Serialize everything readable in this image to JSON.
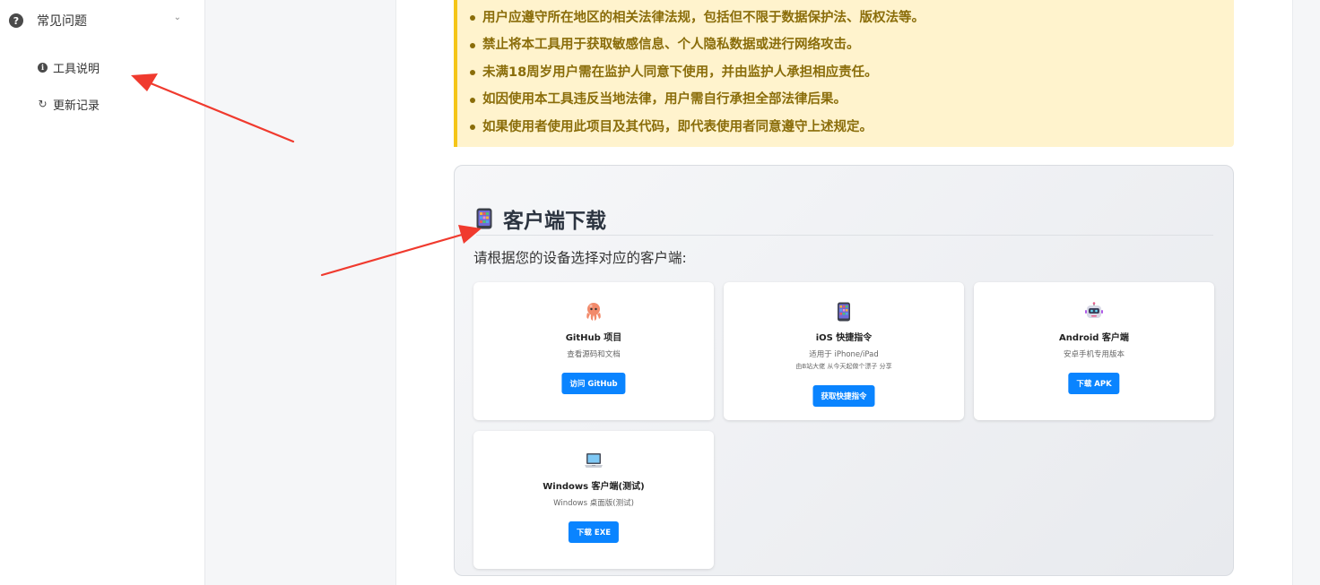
{
  "sidebar": {
    "faq_label": "常见问题",
    "items": [
      {
        "label": "工具说明",
        "icon": "info-icon"
      },
      {
        "label": "更新记录",
        "icon": "refresh-icon"
      }
    ]
  },
  "warning": {
    "items": [
      "用户应遵守所在地区的相关法律法规，包括但不限于数据保护法、版权法等。",
      "禁止将本工具用于获取敏感信息、个人隐私数据或进行网络攻击。",
      "未满18周岁用户需在监护人同意下使用，并由监护人承担相应责任。",
      "如因使用本工具违反当地法律，用户需自行承担全部法律后果。",
      "如果使用者使用此项目及其代码，即代表使用者同意遵守上述规定。"
    ]
  },
  "download": {
    "title": "客户端下载",
    "subtitle": "请根据您的设备选择对应的客户端:",
    "cards": [
      {
        "icon": "octopus-icon",
        "title": "GitHub 项目",
        "desc": "查看源码和文档",
        "button": "访问 GitHub"
      },
      {
        "icon": "phone-icon",
        "title": "iOS 快捷指令",
        "desc": "适用于 iPhone/iPad",
        "note": "由B站大佬 从今天起做个漂子 分享",
        "button": "获取快捷指令"
      },
      {
        "icon": "robot-icon",
        "title": "Android 客户端",
        "desc": "安卓手机专用版本",
        "button": "下载 APK"
      },
      {
        "icon": "laptop-icon",
        "title": "Windows 客户端(测试)",
        "desc": "Windows 桌面版(测试)",
        "button": "下载 EXE"
      }
    ]
  },
  "colors": {
    "accent": "#0a84ff",
    "warning_bg": "#fff3cd",
    "warning_border": "#f5c518",
    "warning_text": "#8a6d0a",
    "annotation": "#f03a2e"
  }
}
